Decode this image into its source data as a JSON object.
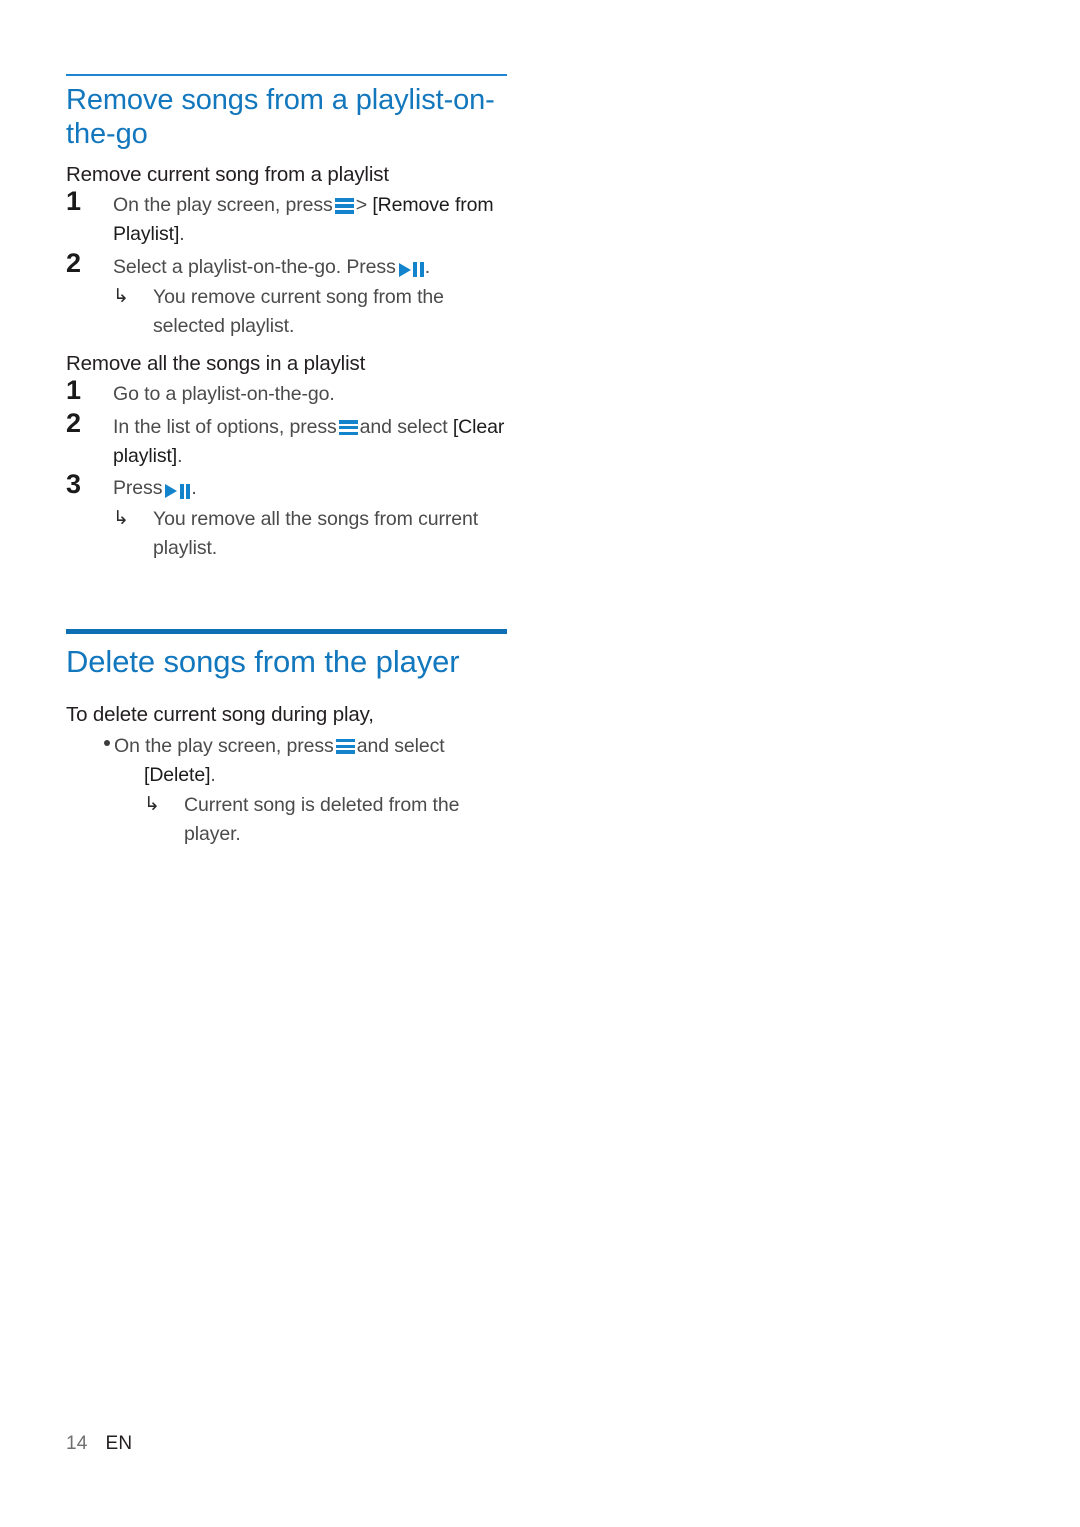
{
  "page": {
    "number": "14",
    "language": "EN"
  },
  "colors": {
    "heading_blue": "#1277bd",
    "rule_blue_thin": "#1e85d2",
    "rule_blue_thick": "#0f6fb4",
    "icon_blue": "#1383cb",
    "body_gray": "#4b4b4b",
    "subheading_dark": "#231f20"
  },
  "icons": {
    "menu": "menu-icon",
    "play_pause": "play-pause-icon",
    "result_arrow": "↳",
    "bullet": "•"
  },
  "sections": [
    {
      "id": "remove-songs",
      "title": "Remove songs from a playlist-on-the-go",
      "groups": [
        {
          "id": "remove-current-song",
          "subtitle": "Remove current song from a playlist",
          "steps": [
            {
              "num": "1",
              "text_before": "On the play screen, press",
              "icon": "menu-icon",
              "text_mid": "> ",
              "bracket": "[Remove from Playlist]",
              "text_after": "."
            },
            {
              "num": "2",
              "text_before": "Select a playlist-on-the-go. Press",
              "icon": "play-pause-icon",
              "text_after": ".",
              "result": "You remove current song from the selected playlist."
            }
          ]
        },
        {
          "id": "remove-all-songs",
          "subtitle": "Remove all the songs in a playlist",
          "steps": [
            {
              "num": "1",
              "text_before": "Go to a playlist-on-the-go."
            },
            {
              "num": "2",
              "text_before": "In the list of options, press",
              "icon": "menu-icon",
              "text_mid": "and select ",
              "bracket": "[Clear playlist]",
              "text_after": "."
            },
            {
              "num": "3",
              "text_before": "Press",
              "icon": "play-pause-icon",
              "text_after": ".",
              "result": "You remove all the songs from current playlist."
            }
          ]
        }
      ]
    },
    {
      "id": "delete-songs",
      "title": "Delete songs from the player",
      "groups": [
        {
          "id": "delete-current-song",
          "subtitle": "To delete current song during play,",
          "steps": [
            {
              "bullet": "•",
              "text_before": "On the play screen, press",
              "icon": "menu-icon",
              "text_mid": "and select ",
              "bracket": "[Delete]",
              "text_after": ".",
              "result": "Current song is deleted from the player."
            }
          ]
        }
      ]
    }
  ]
}
